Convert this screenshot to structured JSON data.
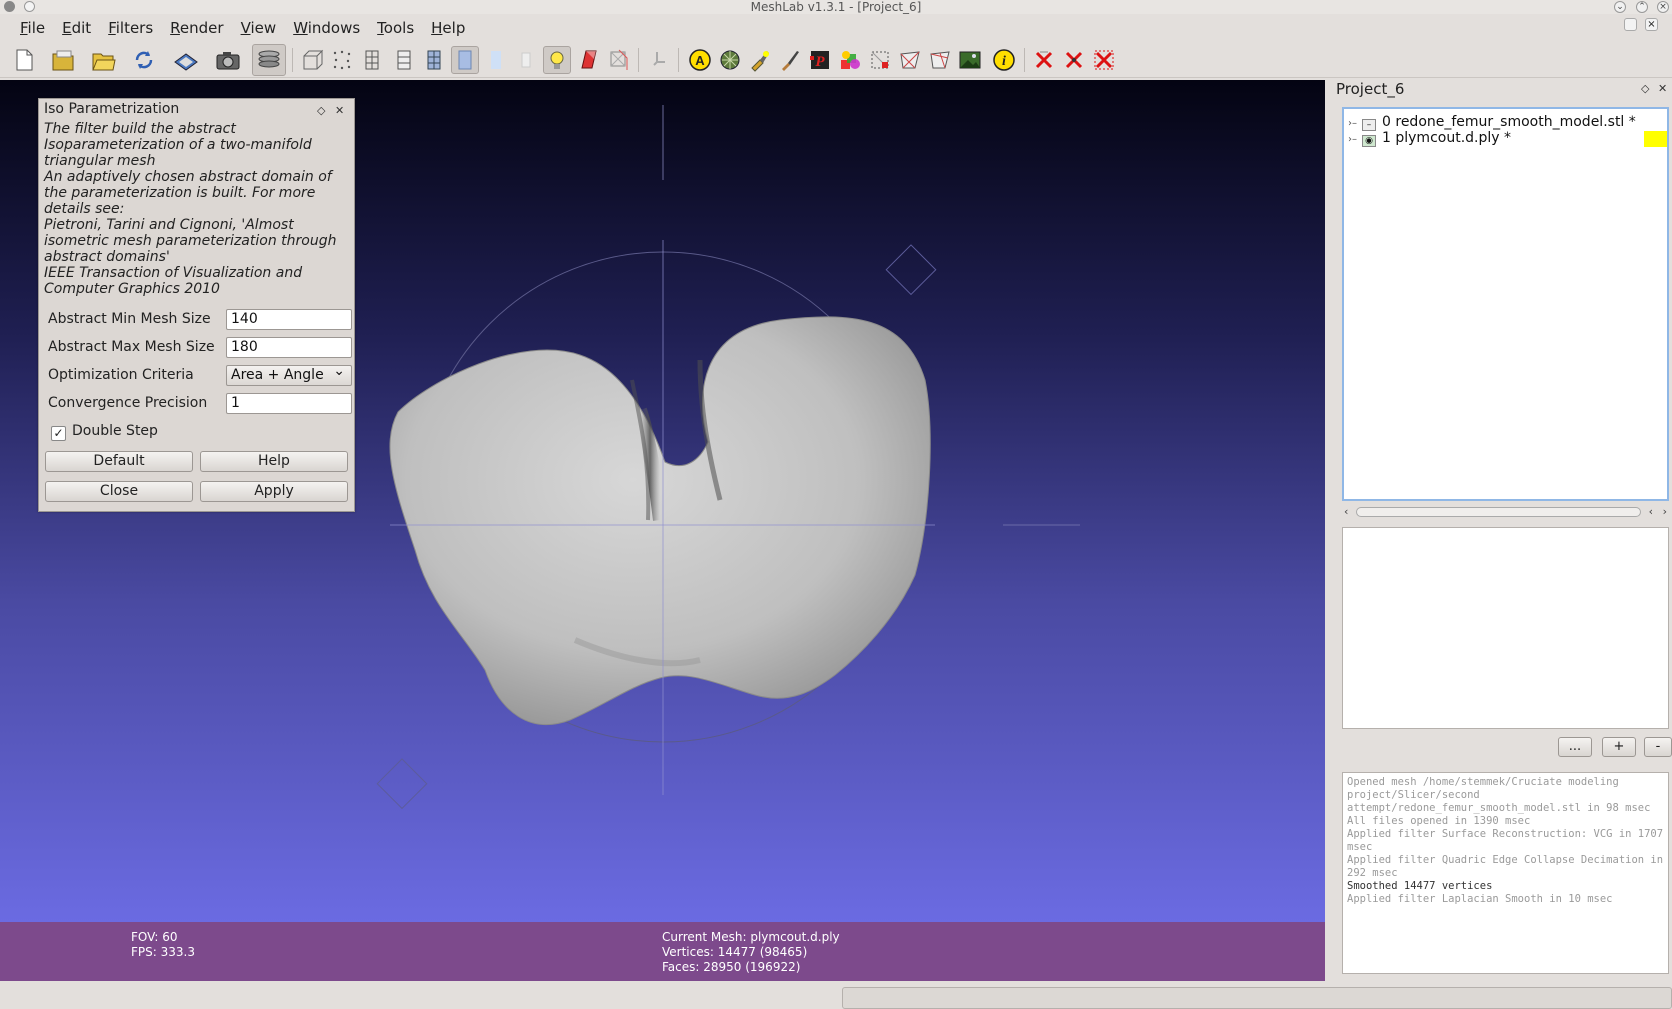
{
  "window": {
    "title": "MeshLab v1.3.1 - [Project_6]"
  },
  "menu": {
    "items": [
      "File",
      "Edit",
      "Filters",
      "Render",
      "View",
      "Windows",
      "Tools",
      "Help"
    ]
  },
  "toolbar": {
    "icons": [
      "new-project-icon",
      "open-project-icon",
      "open-mesh-icon",
      "reload-icon",
      "save-icon",
      "snapshot-icon",
      "layers-icon",
      "bbox-icon",
      "points-icon",
      "wireframe-icon",
      "hidden-lines-icon",
      "flat-lines-icon",
      "flat-icon",
      "smooth-icon",
      "texture-icon",
      "light-icon",
      "backface-icon",
      "double-side-icon",
      "manipulator-icon",
      "annotate-icon",
      "fancy-render-icon",
      "paint-brush-icon",
      "color-paint-icon",
      "pick-points-icon",
      "measure-icon",
      "select-faces-icon",
      "select-vertices-icon",
      "select-connected-icon",
      "raster-icon",
      "info-icon",
      "delete-faces-icon",
      "delete-vertices-icon",
      "delete-selection-icon"
    ]
  },
  "iso_dialog": {
    "title": "Iso Parametrization",
    "description": [
      "The filter build the abstract",
      "Isoparameterization of a two-manifold",
      "triangular mesh",
      "An adaptively chosen abstract domain of",
      "the parameterization is built. For more",
      "details see:",
      "Pietroni, Tarini and Cignoni, 'Almost",
      "isometric mesh parameterization through",
      "abstract domains'",
      "IEEE Transaction of Visualization and",
      "Computer Graphics 2010"
    ],
    "fields": [
      {
        "label": "Abstract Min Mesh Size",
        "value": "140"
      },
      {
        "label": "Abstract Max Mesh Size",
        "value": "180"
      },
      {
        "label": "Optimization Criteria",
        "value": "Area + Angle"
      },
      {
        "label": "Convergence Precision",
        "value": "1"
      }
    ],
    "double_step_label": "Double Step",
    "double_step_checked": "✓",
    "buttons": {
      "default": "Default",
      "help": "Help",
      "close": "Close",
      "apply": "Apply"
    }
  },
  "viewport": {
    "fov": "FOV: 60",
    "fps": "FPS:   333.3",
    "current_mesh": "Current Mesh: plymcout.d.ply",
    "vertices": "Vertices: 14477 (98465)",
    "faces": "Faces: 28950 (196922)"
  },
  "project_panel": {
    "title": "Project_6",
    "layers": [
      {
        "index": "0",
        "name": "redone_femur_smooth_model.stl *"
      },
      {
        "index": "1",
        "name": "plymcout.d.ply *"
      }
    ],
    "current_layer_color": "#ffff00",
    "buttons": {
      "more": "...",
      "add": "+",
      "remove": "-"
    }
  },
  "log": {
    "lines": [
      "Opened mesh /home/stemmek/Cruciate modeling project/Slicer/second attempt/redone_femur_smooth_model.stl in 98 msec",
      "All files opened in 1390 msec",
      "Applied filter Surface Reconstruction: VCG in 1707 msec",
      "Applied filter Quadric Edge Collapse Decimation in 292 msec",
      "Smoothed 14477 vertices",
      "Applied filter Laplacian Smooth in 10 msec"
    ]
  }
}
